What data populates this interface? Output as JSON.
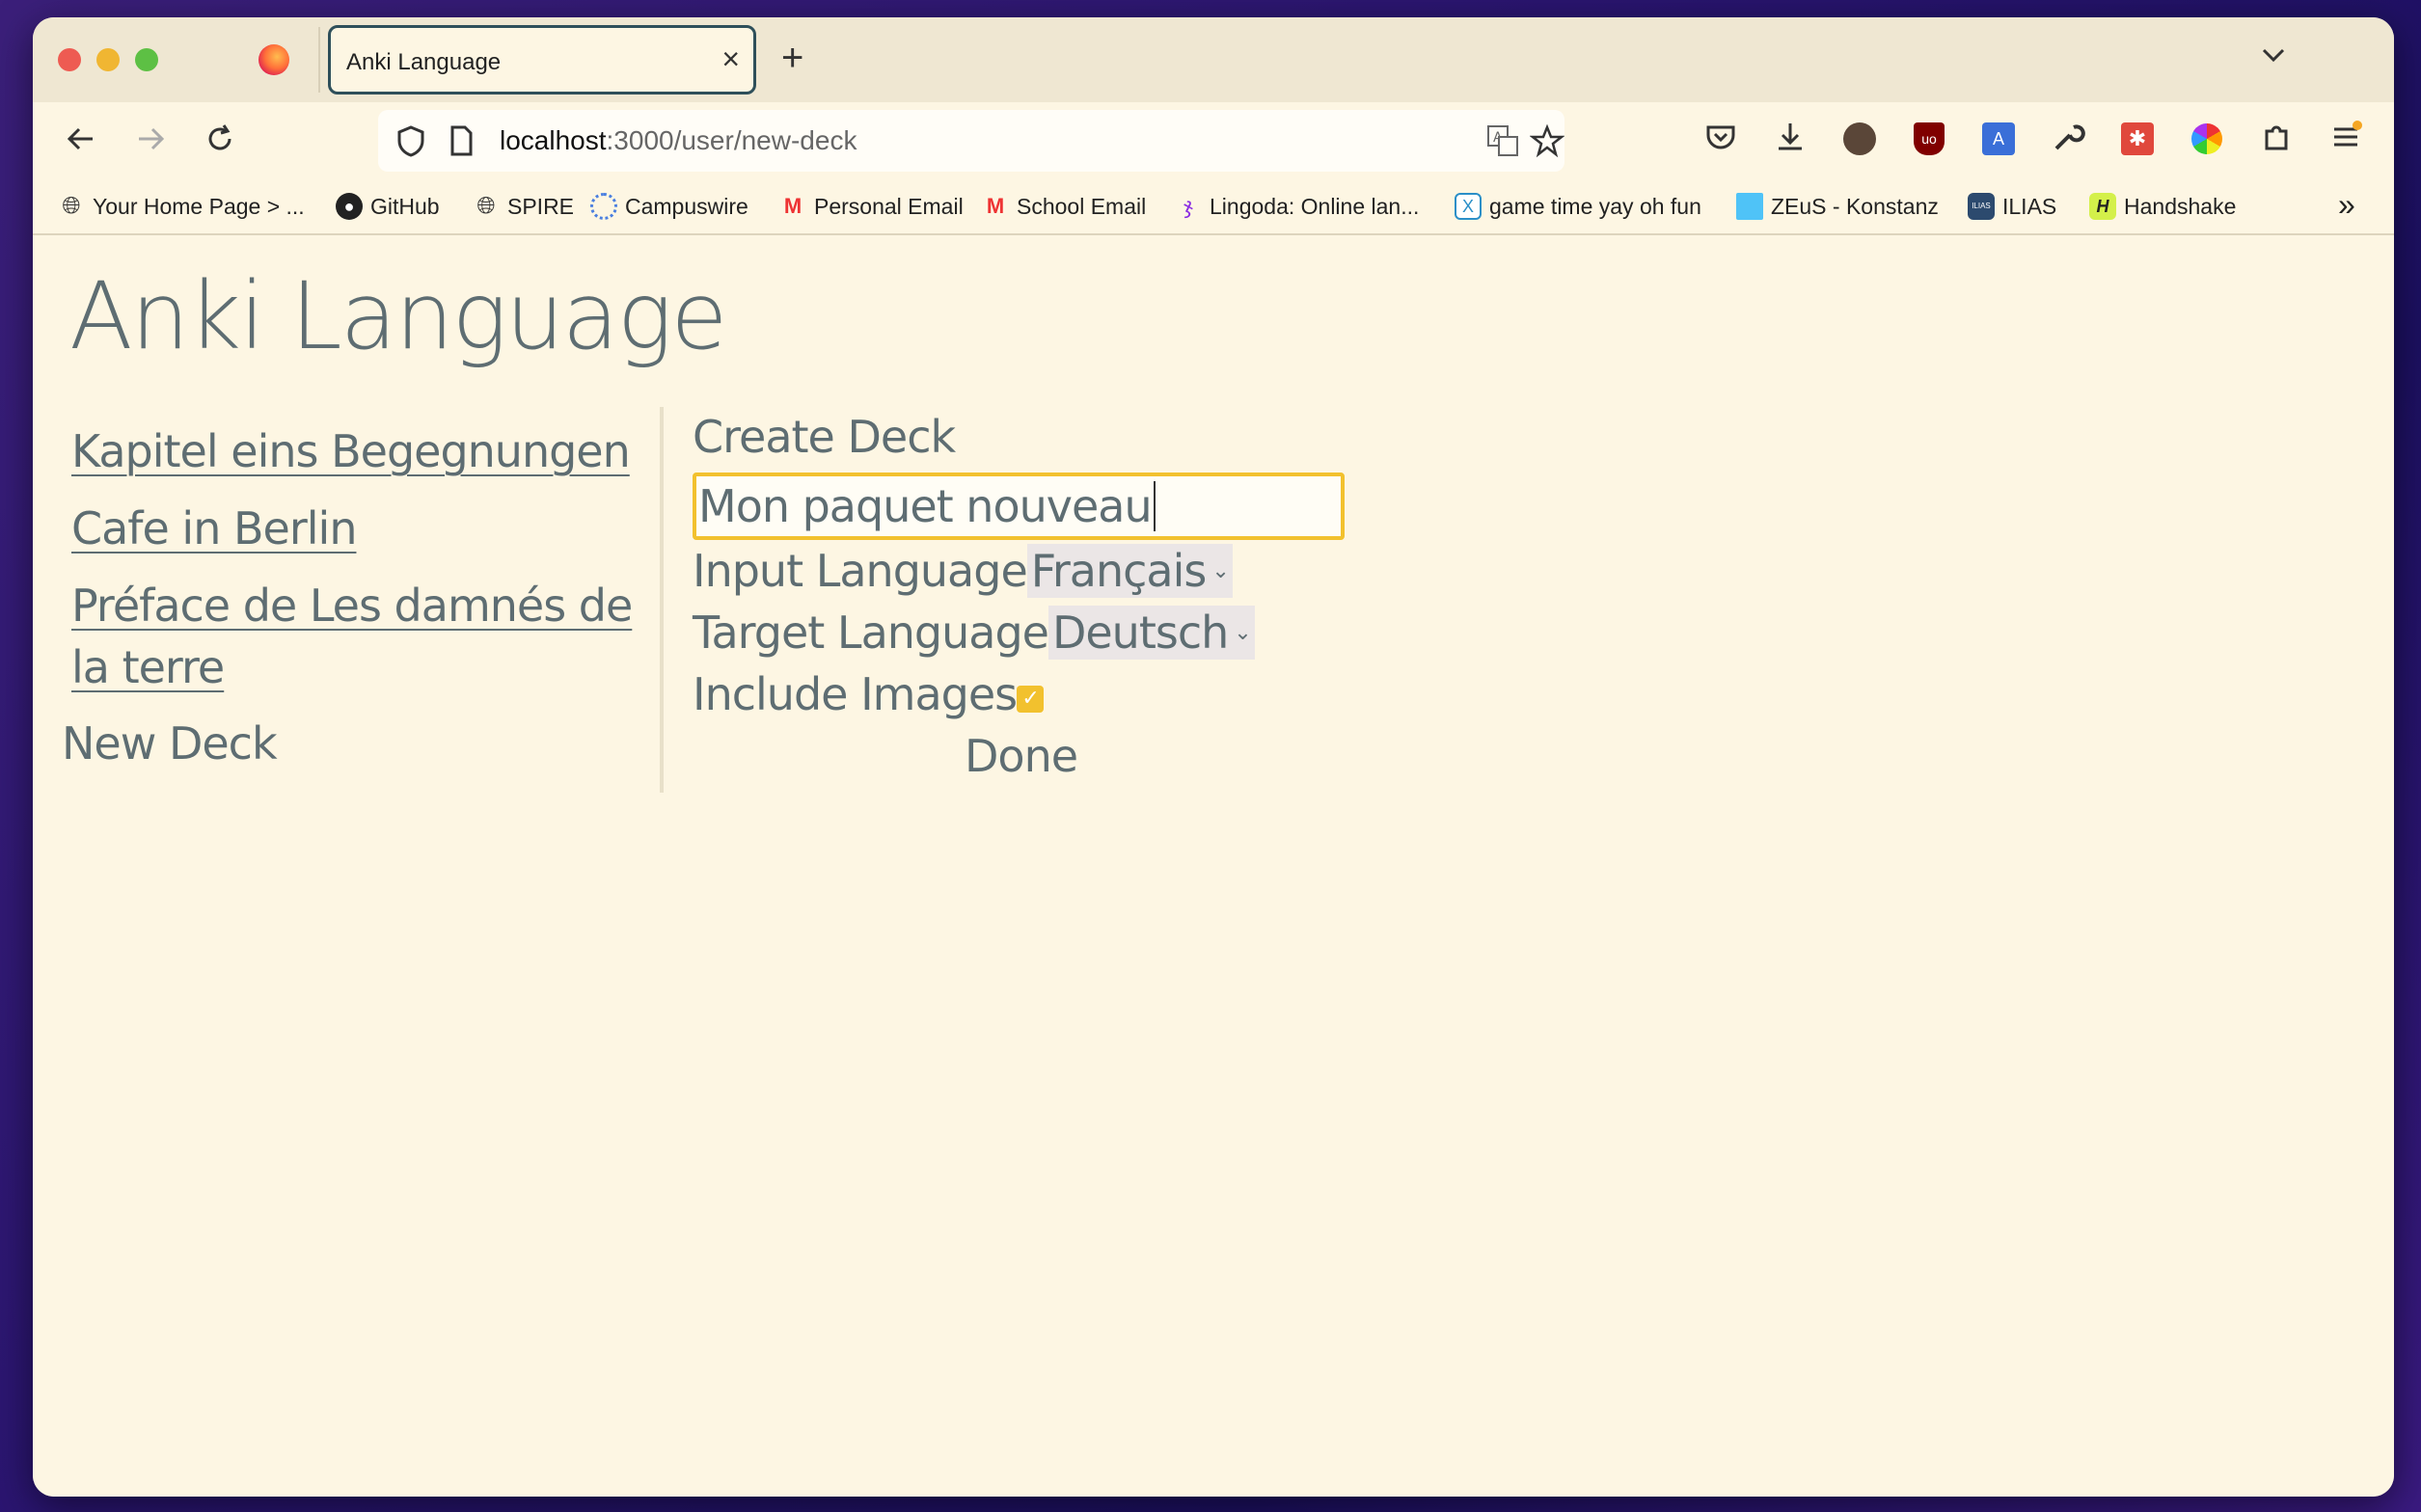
{
  "browser": {
    "tab_title": "Anki Language",
    "tab_close": "×",
    "new_tab": "+",
    "url_host": "localhost",
    "url_path": ":3000/user/new-deck",
    "bookmarks": [
      {
        "label": "Your Home Page > ...",
        "icon": "globe-icon"
      },
      {
        "label": "GitHub",
        "icon": "github-icon"
      },
      {
        "label": "SPIRE",
        "icon": "globe-icon"
      },
      {
        "label": "Campuswire",
        "icon": "campuswire-icon"
      },
      {
        "label": "Personal Email",
        "icon": "gmail-icon"
      },
      {
        "label": "School Email",
        "icon": "gmail-icon"
      },
      {
        "label": "Lingoda: Online lan...",
        "icon": "lingoda-icon"
      },
      {
        "label": "game time yay oh fun",
        "icon": "x-icon"
      },
      {
        "label": "ZEuS - Konstanz",
        "icon": "zeus-icon"
      },
      {
        "label": "ILIAS",
        "icon": "ilias-icon"
      },
      {
        "label": "Handshake",
        "icon": "handshake-icon"
      }
    ]
  },
  "app": {
    "title": "Anki Language",
    "decks": [
      "Kapitel eins Begegnungen",
      "Cafe in Berlin",
      "Préface de Les damnés de la terre"
    ],
    "new_deck": "New Deck"
  },
  "form": {
    "title": "Create Deck",
    "deck_name_value": "Mon paquet nouveau",
    "input_language_label": "Input Language",
    "input_language_value": "Français",
    "target_language_label": "Target Language",
    "target_language_value": "Deutsch",
    "include_images_label": "Include Images",
    "include_images_checked": true,
    "done_label": "Done"
  },
  "colors": {
    "page_bg": "#fdf6e3",
    "text": "#5e6d72",
    "accent": "#f2c12e"
  }
}
